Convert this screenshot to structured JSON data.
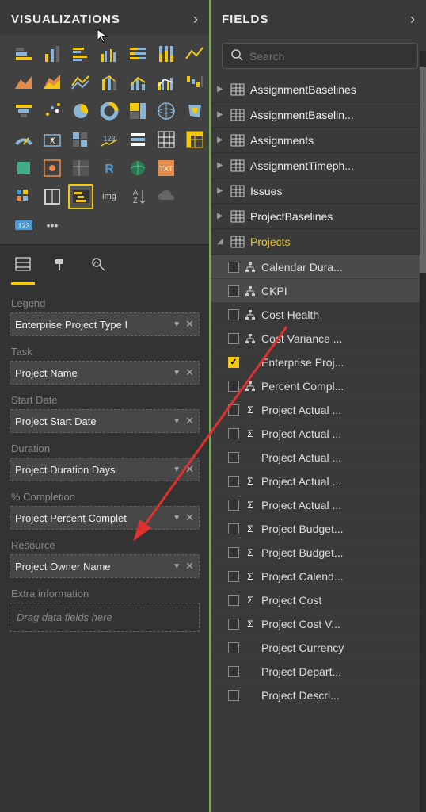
{
  "viz": {
    "title": "VISUALIZATIONS",
    "selected_index": 44,
    "wells": [
      {
        "label": "Legend",
        "value": "Enterprise Project Type I"
      },
      {
        "label": "Task",
        "value": "Project Name"
      },
      {
        "label": "Start Date",
        "value": "Project Start Date"
      },
      {
        "label": "Duration",
        "value": "Project Duration Days"
      },
      {
        "label": "% Completion",
        "value": "Project Percent Complet"
      },
      {
        "label": "Resource",
        "value": "Project Owner Name"
      }
    ],
    "extra_label": "Extra information",
    "extra_placeholder": "Drag data fields here"
  },
  "fields": {
    "title": "FIELDS",
    "search_placeholder": "Search",
    "tables": [
      {
        "name": "AssignmentBaselines",
        "expanded": false
      },
      {
        "name": "AssignmentBaselin...",
        "expanded": false
      },
      {
        "name": "Assignments",
        "expanded": false
      },
      {
        "name": "AssignmentTimeph...",
        "expanded": false
      },
      {
        "name": "Issues",
        "expanded": false
      },
      {
        "name": "ProjectBaselines",
        "expanded": false
      },
      {
        "name": "Projects",
        "expanded": true,
        "fields": [
          {
            "name": "Calendar Dura...",
            "checked": false,
            "icon": "hier",
            "hovered": true
          },
          {
            "name": "CKPI",
            "checked": false,
            "icon": "hier",
            "hovered": true
          },
          {
            "name": "Cost Health",
            "checked": false,
            "icon": "hier"
          },
          {
            "name": "Cost Variance ...",
            "checked": false,
            "icon": "hier"
          },
          {
            "name": "Enterprise Proj...",
            "checked": true,
            "icon": ""
          },
          {
            "name": "Percent Compl...",
            "checked": false,
            "icon": "hier"
          },
          {
            "name": "Project Actual ...",
            "checked": false,
            "icon": "sum"
          },
          {
            "name": "Project Actual ...",
            "checked": false,
            "icon": "sum"
          },
          {
            "name": "Project Actual ...",
            "checked": false,
            "icon": ""
          },
          {
            "name": "Project Actual ...",
            "checked": false,
            "icon": "sum"
          },
          {
            "name": "Project Actual ...",
            "checked": false,
            "icon": "sum"
          },
          {
            "name": "Project Budget...",
            "checked": false,
            "icon": "sum"
          },
          {
            "name": "Project Budget...",
            "checked": false,
            "icon": "sum"
          },
          {
            "name": "Project Calend...",
            "checked": false,
            "icon": "sum"
          },
          {
            "name": "Project Cost",
            "checked": false,
            "icon": "sum"
          },
          {
            "name": "Project Cost V...",
            "checked": false,
            "icon": "sum"
          },
          {
            "name": "Project Currency",
            "checked": false,
            "icon": ""
          },
          {
            "name": "Project Depart...",
            "checked": false,
            "icon": ""
          },
          {
            "name": "Project Descri...",
            "checked": false,
            "icon": ""
          }
        ]
      }
    ]
  },
  "colors": {
    "accent": "#f2c811",
    "green": "#6fb24a"
  }
}
